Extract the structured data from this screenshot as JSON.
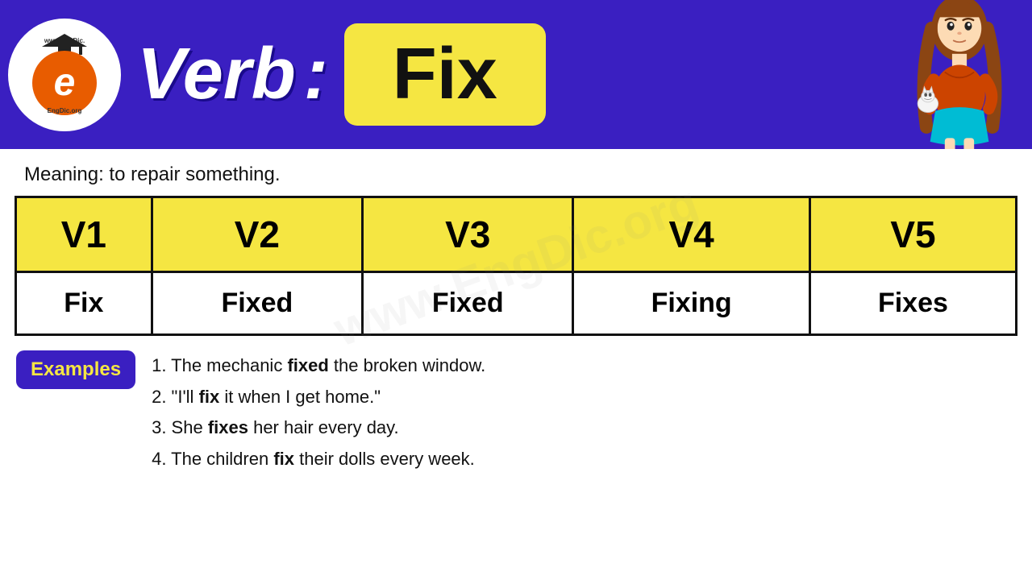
{
  "header": {
    "logo_site": "www.EngDic.org",
    "verb_label": "Verb",
    "colon": ":",
    "word": "Fix"
  },
  "meaning": {
    "label": "Meaning:",
    "text": "to repair something."
  },
  "table": {
    "headers": [
      "V1",
      "V2",
      "V3",
      "V4",
      "V5"
    ],
    "values": [
      "Fix",
      "Fixed",
      "Fixed",
      "Fixing",
      "Fixes"
    ]
  },
  "examples": {
    "badge": "Examples",
    "items": [
      {
        "number": "1.",
        "pre": "The mechanic ",
        "bold": "fixed",
        "post": " the broken window."
      },
      {
        "number": "2.",
        "pre": "\"I'll ",
        "bold": "fix",
        "post": " it when I get home.\""
      },
      {
        "number": "3.",
        "pre": "She ",
        "bold": "fixes",
        "post": " her hair every day."
      },
      {
        "number": "4.",
        "pre": "The children ",
        "bold": "fix",
        "post": " their dolls every week."
      }
    ]
  }
}
